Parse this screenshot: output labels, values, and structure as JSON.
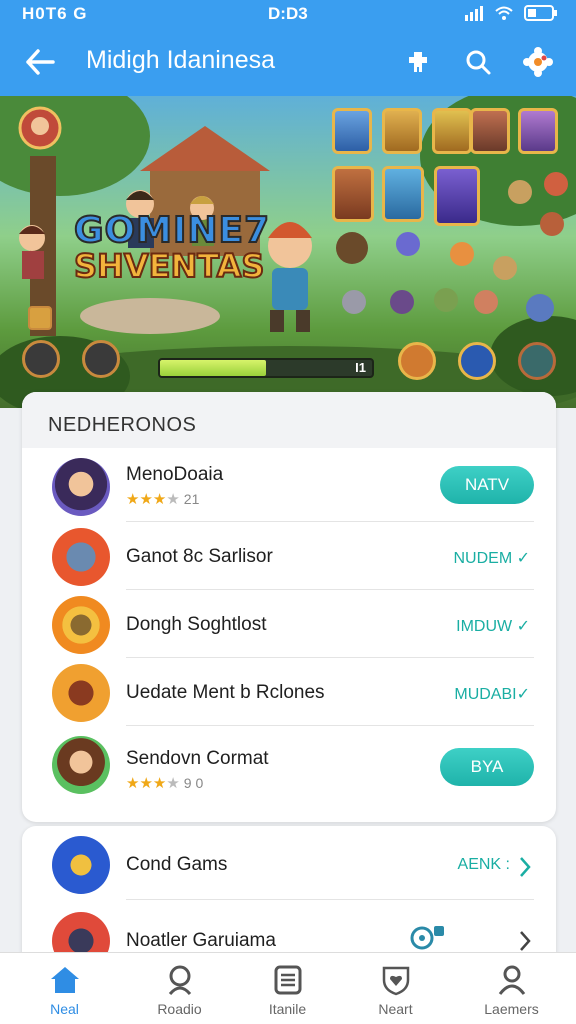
{
  "status_bar": {
    "time": "H0T6 G",
    "center": "D:D3",
    "battery": ""
  },
  "app_bar": {
    "title": "Midigh Idaninesa",
    "back_icon": "arrow-left-icon",
    "actions": [
      "puzzle-icon",
      "search-icon",
      "settings-gear-icon"
    ]
  },
  "banner": {
    "logo_line1": "GOMINE7",
    "logo_line2": "SHVENTAS",
    "progress_value": 0.5,
    "progress_label": "I1",
    "colors": {
      "sky": "#5fb0d8",
      "grass": "#5d9b3e"
    }
  },
  "section": {
    "header": "NEDHERONOS",
    "items": [
      {
        "name": "MenoDoaia",
        "stars_filled": "★★★",
        "stars_empty": "★",
        "rating": "21",
        "action": "NATV",
        "action_style": "pill",
        "icon": "hero-avatar-icon"
      },
      {
        "name": "Ganot 8c Sarlisor",
        "action": "NUDEM ✓",
        "action_style": "text",
        "icon": "shield-badge-icon"
      },
      {
        "name": "Dongh Soghtlost",
        "action": "IMDUW ✓",
        "action_style": "text",
        "icon": "coin-token-icon"
      },
      {
        "name": "Uedate Ment b Rclones",
        "action": "MUDABI✓",
        "action_style": "text",
        "icon": "fox-emblem-icon"
      },
      {
        "name": "Sendovn Cormat",
        "stars_filled": "★★★",
        "stars_empty": "★",
        "rating": "9 0",
        "action": "BYA",
        "action_style": "pill",
        "icon": "character-portrait-icon"
      }
    ]
  },
  "section2": {
    "items": [
      {
        "name": "Cond Gams",
        "action": "AENK :",
        "icon": "sword-game-icon"
      },
      {
        "name": "Noatler Garuiama",
        "action": "",
        "icon": "crest-game-icon"
      }
    ]
  },
  "bottom_nav": [
    {
      "label": "Neal",
      "icon": "home-icon",
      "active": true
    },
    {
      "label": "Roadio",
      "icon": "search-icon",
      "active": false
    },
    {
      "label": "Itanile",
      "icon": "document-icon",
      "active": false
    },
    {
      "label": "Neart",
      "icon": "heart-shield-icon",
      "active": false
    },
    {
      "label": "Laemers",
      "icon": "profile-icon",
      "active": false
    }
  ],
  "accent": "#3a9ef0",
  "teal": "#1fb3aa"
}
